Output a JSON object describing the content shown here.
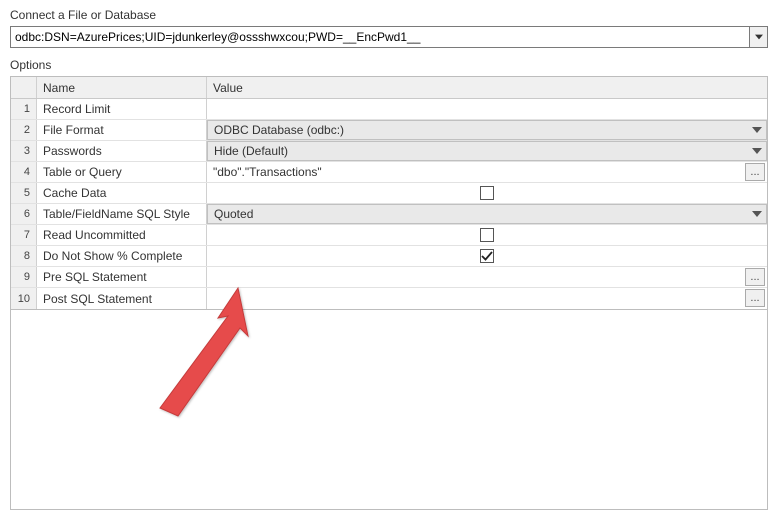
{
  "header": {
    "section_label": "Connect a File or Database",
    "connection_string": "odbc:DSN=AzurePrices;UID=jdunkerley@ossshwxcou;PWD=__EncPwd1__"
  },
  "options_label": "Options",
  "columns": {
    "name": "Name",
    "value": "Value"
  },
  "rows": [
    {
      "num": "1",
      "name": "Record Limit",
      "type": "text",
      "value": ""
    },
    {
      "num": "2",
      "name": "File Format",
      "type": "dropdown",
      "value": "ODBC Database (odbc:)"
    },
    {
      "num": "3",
      "name": "Passwords",
      "type": "dropdown",
      "value": "Hide (Default)"
    },
    {
      "num": "4",
      "name": "Table or Query",
      "type": "browse",
      "value": "\"dbo\".\"Transactions\""
    },
    {
      "num": "5",
      "name": "Cache Data",
      "type": "check",
      "checked": false
    },
    {
      "num": "6",
      "name": "Table/FieldName SQL Style",
      "type": "dropdown",
      "value": "Quoted"
    },
    {
      "num": "7",
      "name": "Read Uncommitted",
      "type": "check",
      "checked": false
    },
    {
      "num": "8",
      "name": "Do Not Show % Complete",
      "type": "check",
      "checked": true
    },
    {
      "num": "9",
      "name": "Pre SQL Statement",
      "type": "browse",
      "value": ""
    },
    {
      "num": "10",
      "name": "Post SQL Statement",
      "type": "browse",
      "value": ""
    }
  ],
  "browse_label": "..."
}
